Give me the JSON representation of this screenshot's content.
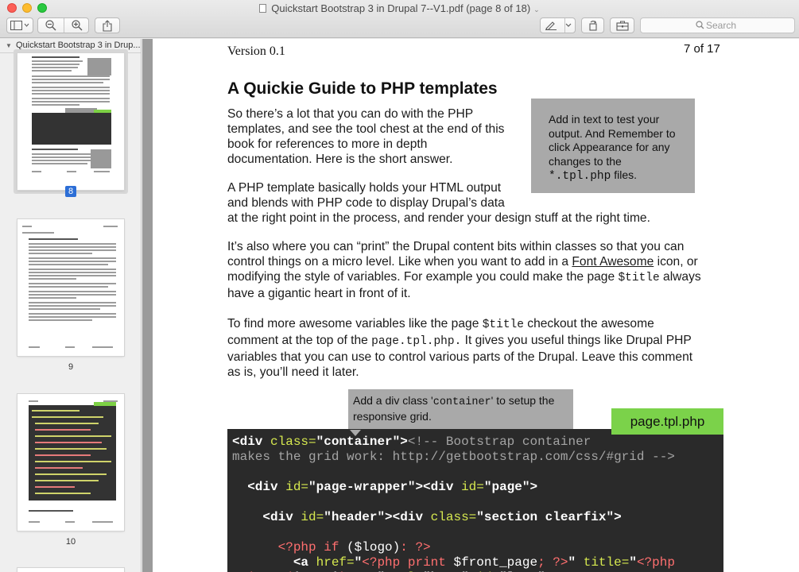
{
  "window": {
    "title": "Quickstart Bootstrap 3 in Drupal 7--V1.pdf (page 8 of 18)",
    "title_chevron": "⌄"
  },
  "toolbar": {
    "search_placeholder": "Search"
  },
  "sidebar": {
    "header": "Quickstart Bootstrap 3 in Drup...",
    "pages": [
      {
        "number": "8",
        "selected": true
      },
      {
        "number": "9",
        "selected": false
      },
      {
        "number": "10",
        "selected": false
      }
    ]
  },
  "page": {
    "version": "Version 0.1",
    "page_count": "7 of 17",
    "heading": "A Quickie Guide to PHP templates",
    "p1_lines": [
      "So there’s a lot that you can do with the PHP",
      "templates, and see the tool chest at the end of this",
      "book for references to more in depth",
      "documentation. Here is the short answer."
    ],
    "note_lines": [
      "Add in text to test your",
      "output. And Remember to",
      "click Appearance for any",
      "changes to the"
    ],
    "note_code": "*.tpl.php",
    "note_suffix": " files.",
    "p2_lines": [
      "A PHP template basically holds your HTML output",
      "and blends with PHP code to display Drupal’s data",
      "at the right point in the process, and render your design stuff at the right time."
    ],
    "p3": {
      "l1": "It’s also where you can “print” the Drupal content bits within classes so that you can",
      "l2_before": "control things on a micro level. Like when you want to add in a ",
      "l2_link": "Font Awesome",
      "l2_after": " icon, or",
      "l3_before": "modifying the style of variables. For example you could make the page ",
      "l3_code": "$title",
      "l3_after": " always",
      "l4": "have a gigantic heart in front of it."
    },
    "p4": {
      "l1_before": "To find more awesome variables like the page ",
      "l1_code": "$title",
      "l1_after": " checkout the awesome",
      "l2_before": "comment at the top of the ",
      "l2_code": "page.tpl.php.",
      "l2_after": " It gives you useful things like Drupal PHP",
      "l3": "variables that you can use to control various parts of the Drupal.  Leave this comment",
      "l4": "as is, you’ll need it later."
    },
    "callout": {
      "before": "Add a div class '",
      "code": "container",
      "after": "' to setup the",
      "line2": "responsive grid."
    },
    "filetag": "page.tpl.php"
  }
}
